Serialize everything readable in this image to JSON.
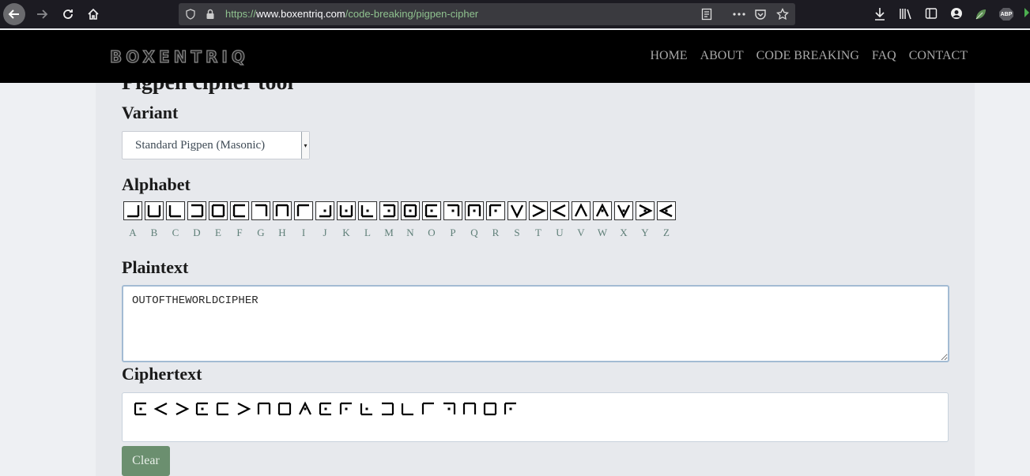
{
  "browser": {
    "url_scheme": "https://",
    "url_host": "www.boxentriq.com",
    "url_path": "/code-breaking/pigpen-cipher",
    "abp_badge": "ABP"
  },
  "site": {
    "logo": "BOXENTRIQ",
    "nav": [
      "HOME",
      "ABOUT",
      "CODE BREAKING",
      "FAQ",
      "CONTACT"
    ]
  },
  "tool": {
    "title": "Pigpen cipher tool",
    "variant_label": "Variant",
    "variant_value": "Standard Pigpen (Masonic)",
    "alphabet_label": "Alphabet",
    "letters": [
      "A",
      "B",
      "C",
      "D",
      "E",
      "F",
      "G",
      "H",
      "I",
      "J",
      "K",
      "L",
      "M",
      "N",
      "O",
      "P",
      "Q",
      "R",
      "S",
      "T",
      "U",
      "V",
      "W",
      "X",
      "Y",
      "Z"
    ],
    "plaintext_label": "Plaintext",
    "plaintext_value": "OUTOFTHEWORLDCIPHER",
    "ciphertext_label": "Ciphertext",
    "clear_label": "Clear"
  },
  "colors": {
    "accent_green": "#6b8f6f",
    "letter_color": "#5f7f78",
    "header_bg": "#000000"
  }
}
